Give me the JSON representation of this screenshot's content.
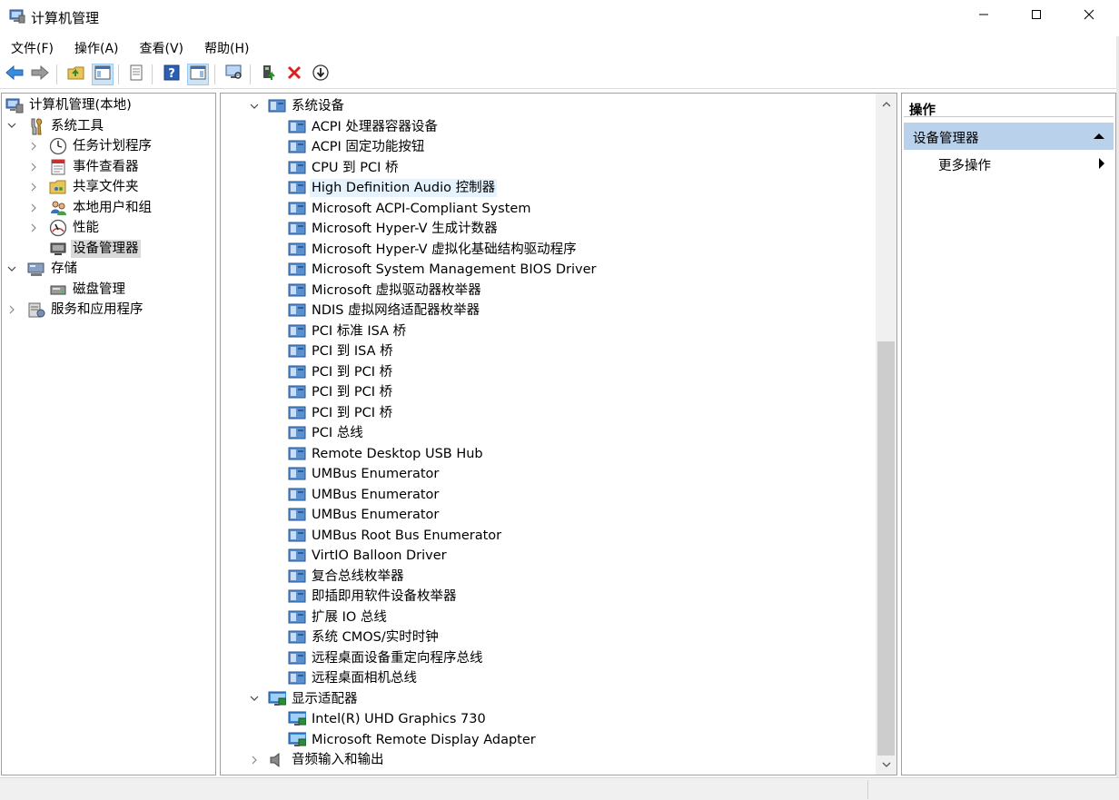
{
  "window": {
    "title": "计算机管理",
    "minimize_icon": "minimize-icon",
    "maximize_icon": "maximize-icon",
    "close_icon": "close-icon"
  },
  "menu": [
    "文件(F)",
    "操作(A)",
    "查看(V)",
    "帮助(H)"
  ],
  "toolbar_icons": [
    "back-arrow-icon",
    "forward-arrow-icon",
    "up-folder-icon",
    "show-hide-tree-icon",
    "properties-icon",
    "help-icon",
    "show-hide-action-pane-icon",
    "monitor-icon",
    "update-driver-icon",
    "uninstall-device-icon",
    "disable-device-icon"
  ],
  "left_tree": [
    {
      "label": "计算机管理(本地)",
      "icon": "computer-management-icon",
      "level": 0,
      "expander": "none"
    },
    {
      "label": "系统工具",
      "icon": "system-tools-icon",
      "level": 1,
      "expander": "expanded"
    },
    {
      "label": "任务计划程序",
      "icon": "clock-icon",
      "level": 2,
      "expander": "collapsed"
    },
    {
      "label": "事件查看器",
      "icon": "event-viewer-icon",
      "level": 2,
      "expander": "collapsed"
    },
    {
      "label": "共享文件夹",
      "icon": "shared-folder-icon",
      "level": 2,
      "expander": "collapsed"
    },
    {
      "label": "本地用户和组",
      "icon": "users-icon",
      "level": 2,
      "expander": "collapsed"
    },
    {
      "label": "性能",
      "icon": "performance-icon",
      "level": 2,
      "expander": "collapsed"
    },
    {
      "label": "设备管理器",
      "icon": "device-manager-icon",
      "level": 2,
      "expander": "none",
      "selected": true
    },
    {
      "label": "存储",
      "icon": "storage-icon",
      "level": 1,
      "expander": "expanded"
    },
    {
      "label": "磁盘管理",
      "icon": "disk-icon",
      "level": 2,
      "expander": "none"
    },
    {
      "label": "服务和应用程序",
      "icon": "services-icon",
      "level": 1,
      "expander": "collapsed"
    }
  ],
  "device_tree": [
    {
      "label": "系统设备",
      "icon": "system-devices-icon",
      "kind": "category",
      "expander": "expanded"
    },
    {
      "label": "ACPI 处理器容器设备",
      "icon": "system-device-icon",
      "kind": "device"
    },
    {
      "label": "ACPI 固定功能按钮",
      "icon": "system-device-icon",
      "kind": "device"
    },
    {
      "label": "CPU 到 PCI 桥",
      "icon": "system-device-icon",
      "kind": "device"
    },
    {
      "label": "High Definition Audio 控制器",
      "icon": "system-device-icon",
      "kind": "device",
      "highlighted": true
    },
    {
      "label": "Microsoft ACPI-Compliant System",
      "icon": "system-device-icon",
      "kind": "device"
    },
    {
      "label": "Microsoft Hyper-V 生成计数器",
      "icon": "system-device-icon",
      "kind": "device"
    },
    {
      "label": "Microsoft Hyper-V 虚拟化基础结构驱动程序",
      "icon": "system-device-icon",
      "kind": "device"
    },
    {
      "label": "Microsoft System Management BIOS Driver",
      "icon": "system-device-icon",
      "kind": "device"
    },
    {
      "label": "Microsoft 虚拟驱动器枚举器",
      "icon": "system-device-icon",
      "kind": "device"
    },
    {
      "label": "NDIS 虚拟网络适配器枚举器",
      "icon": "system-device-icon",
      "kind": "device"
    },
    {
      "label": "PCI 标准 ISA 桥",
      "icon": "system-device-icon",
      "kind": "device"
    },
    {
      "label": "PCI 到 ISA 桥",
      "icon": "system-device-icon",
      "kind": "device"
    },
    {
      "label": "PCI 到 PCI 桥",
      "icon": "system-device-icon",
      "kind": "device"
    },
    {
      "label": "PCI 到 PCI 桥",
      "icon": "system-device-icon",
      "kind": "device"
    },
    {
      "label": "PCI 到 PCI 桥",
      "icon": "system-device-icon",
      "kind": "device"
    },
    {
      "label": "PCI 总线",
      "icon": "system-device-icon",
      "kind": "device"
    },
    {
      "label": "Remote Desktop USB Hub",
      "icon": "system-device-icon",
      "kind": "device"
    },
    {
      "label": "UMBus Enumerator",
      "icon": "system-device-icon",
      "kind": "device"
    },
    {
      "label": "UMBus Enumerator",
      "icon": "system-device-icon",
      "kind": "device"
    },
    {
      "label": "UMBus Enumerator",
      "icon": "system-device-icon",
      "kind": "device"
    },
    {
      "label": "UMBus Root Bus Enumerator",
      "icon": "system-device-icon",
      "kind": "device"
    },
    {
      "label": "VirtIO Balloon Driver",
      "icon": "system-device-icon",
      "kind": "device"
    },
    {
      "label": "复合总线枚举器",
      "icon": "system-device-icon",
      "kind": "device"
    },
    {
      "label": "即插即用软件设备枚举器",
      "icon": "system-device-icon",
      "kind": "device"
    },
    {
      "label": "扩展 IO 总线",
      "icon": "system-device-icon",
      "kind": "device"
    },
    {
      "label": "系统 CMOS/实时时钟",
      "icon": "system-device-icon",
      "kind": "device"
    },
    {
      "label": "远程桌面设备重定向程序总线",
      "icon": "system-device-icon",
      "kind": "device"
    },
    {
      "label": "远程桌面相机总线",
      "icon": "system-device-icon",
      "kind": "device"
    },
    {
      "label": "显示适配器",
      "icon": "display-adapters-icon",
      "kind": "category",
      "expander": "expanded"
    },
    {
      "label": "Intel(R) UHD Graphics 730",
      "icon": "display-adapter-icon",
      "kind": "device"
    },
    {
      "label": "Microsoft Remote Display Adapter",
      "icon": "display-adapter-icon",
      "kind": "device"
    },
    {
      "label": "音频输入和输出",
      "icon": "speaker-icon",
      "kind": "category",
      "expander": "collapsed"
    }
  ],
  "actions": {
    "header": "操作",
    "section": "设备管理器",
    "more": "更多操作"
  }
}
